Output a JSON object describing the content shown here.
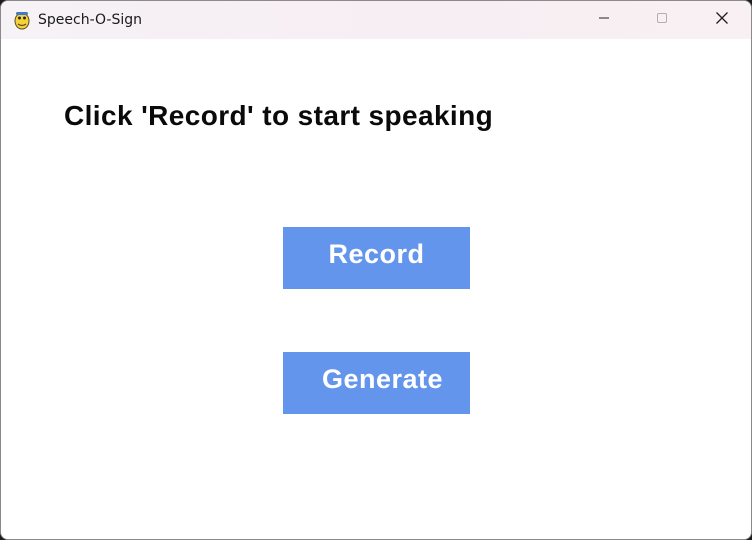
{
  "window": {
    "title": "Speech-O-Sign",
    "controls": {
      "minimize": "minimize-icon",
      "maximize": "maximize-icon",
      "close": "close-icon"
    }
  },
  "main": {
    "prompt": "Click 'Record' to start speaking",
    "record_label": "Record",
    "generate_label": "Generate"
  },
  "colors": {
    "button_bg": "#6495ed",
    "button_text": "#ffffff",
    "prompt_text": "#0a0a0a",
    "background": "#ffffff"
  }
}
